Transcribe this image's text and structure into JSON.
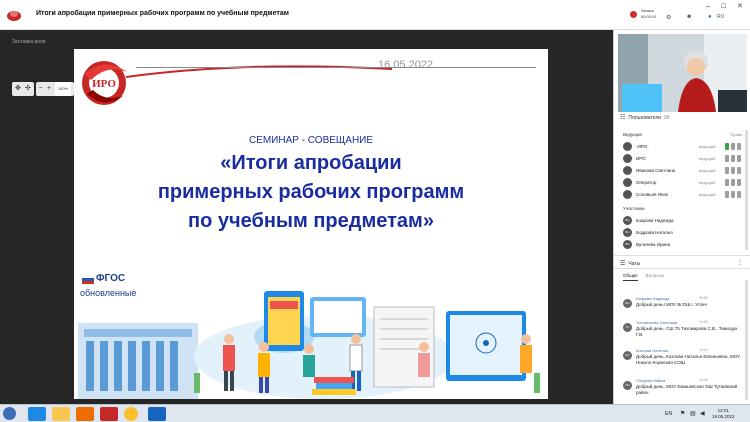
{
  "window": {
    "title": "Итоги апробации примерных рабочих программ по учебным предметам",
    "recording_label": "Запись",
    "recording_time": "00:00:01",
    "lang_badge": "RU"
  },
  "presentation": {
    "label": "Заставка роли",
    "zoom_label": "100%",
    "slide": {
      "date": "16.05.2022",
      "logo_text": "ИРО",
      "subtitle": "СЕМИНАР - СОВЕЩАНИЕ",
      "title_lines": [
        "«Итоги апробации",
        "примерных рабочих программ",
        "по учебным предметам»"
      ],
      "fgos_main": "ФГОС",
      "fgos_sub": "обновленные"
    }
  },
  "users": {
    "header": "Пользователи",
    "count": "99",
    "leaders_label": "Ведущие",
    "rights_label": "Права",
    "leaders": [
      {
        "name": "-ИРО-",
        "role": "ведущий",
        "initials": ""
      },
      {
        "name": "ИРО",
        "role": "ведущий",
        "initials": ""
      },
      {
        "name": "Иванова Светлана",
        "role": "ведущий",
        "initials": ""
      },
      {
        "name": "Оператор",
        "role": "ведущий",
        "initials": ""
      },
      {
        "name": "Соловьев Яков",
        "role": "ведущий",
        "initials": ""
      }
    ],
    "participants_label": "Участники",
    "participants": [
      {
        "name": "Бзарова Надежда",
        "initials": "БН"
      },
      {
        "name": "Бодрова Наталья",
        "initials": "БН"
      },
      {
        "name": "Вульчева Ирина",
        "initials": "ВИ"
      }
    ]
  },
  "chat": {
    "header": "Чаты",
    "tabs": [
      "Общие",
      "Вопросы"
    ],
    "messages": [
      {
        "initials": "БН",
        "author": "Бзарова Надежда",
        "time": "09:55",
        "text": "Добрый день! МОУ ВсОШ г. Углич"
      },
      {
        "initials": "ТС",
        "author": "Тихомирова Светлана",
        "time": "10:02",
        "text": "Добрый день. СШ 75 Тихомирова С.В., Тимощук Г.В."
      },
      {
        "initials": "КН",
        "author": "Козлова Наталья",
        "time": "10:04",
        "text": "Добрый день. Козлова Наталья Евгеньевна, МОУ Николо-Кормская СОШ"
      },
      {
        "initials": "ПН",
        "author": "Полуева Нейжа",
        "time": "10:05",
        "text": "Добрый день. МОУ Емишевская ОШ Тутаевский район"
      }
    ]
  },
  "taskbar": {
    "lang": "EN",
    "time": "12:01",
    "date": "19.05.2022"
  }
}
